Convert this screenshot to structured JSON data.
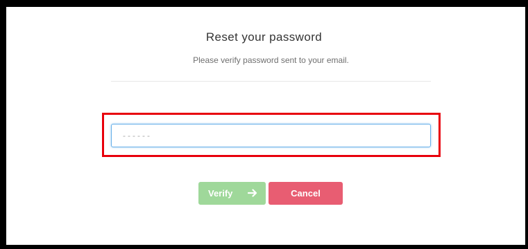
{
  "dialog": {
    "title": "Reset your password",
    "subtitle": "Please verify password sent to your email."
  },
  "password_input": {
    "placeholder": "------",
    "value": ""
  },
  "buttons": {
    "verify_label": "Verify",
    "verify_icon": "arrow-right-icon",
    "cancel_label": "Cancel"
  },
  "colors": {
    "verify_button": "#9fd89a",
    "cancel_button": "#e85d72",
    "highlight_box": "#e8000b",
    "input_focus_border": "#66afe9"
  }
}
